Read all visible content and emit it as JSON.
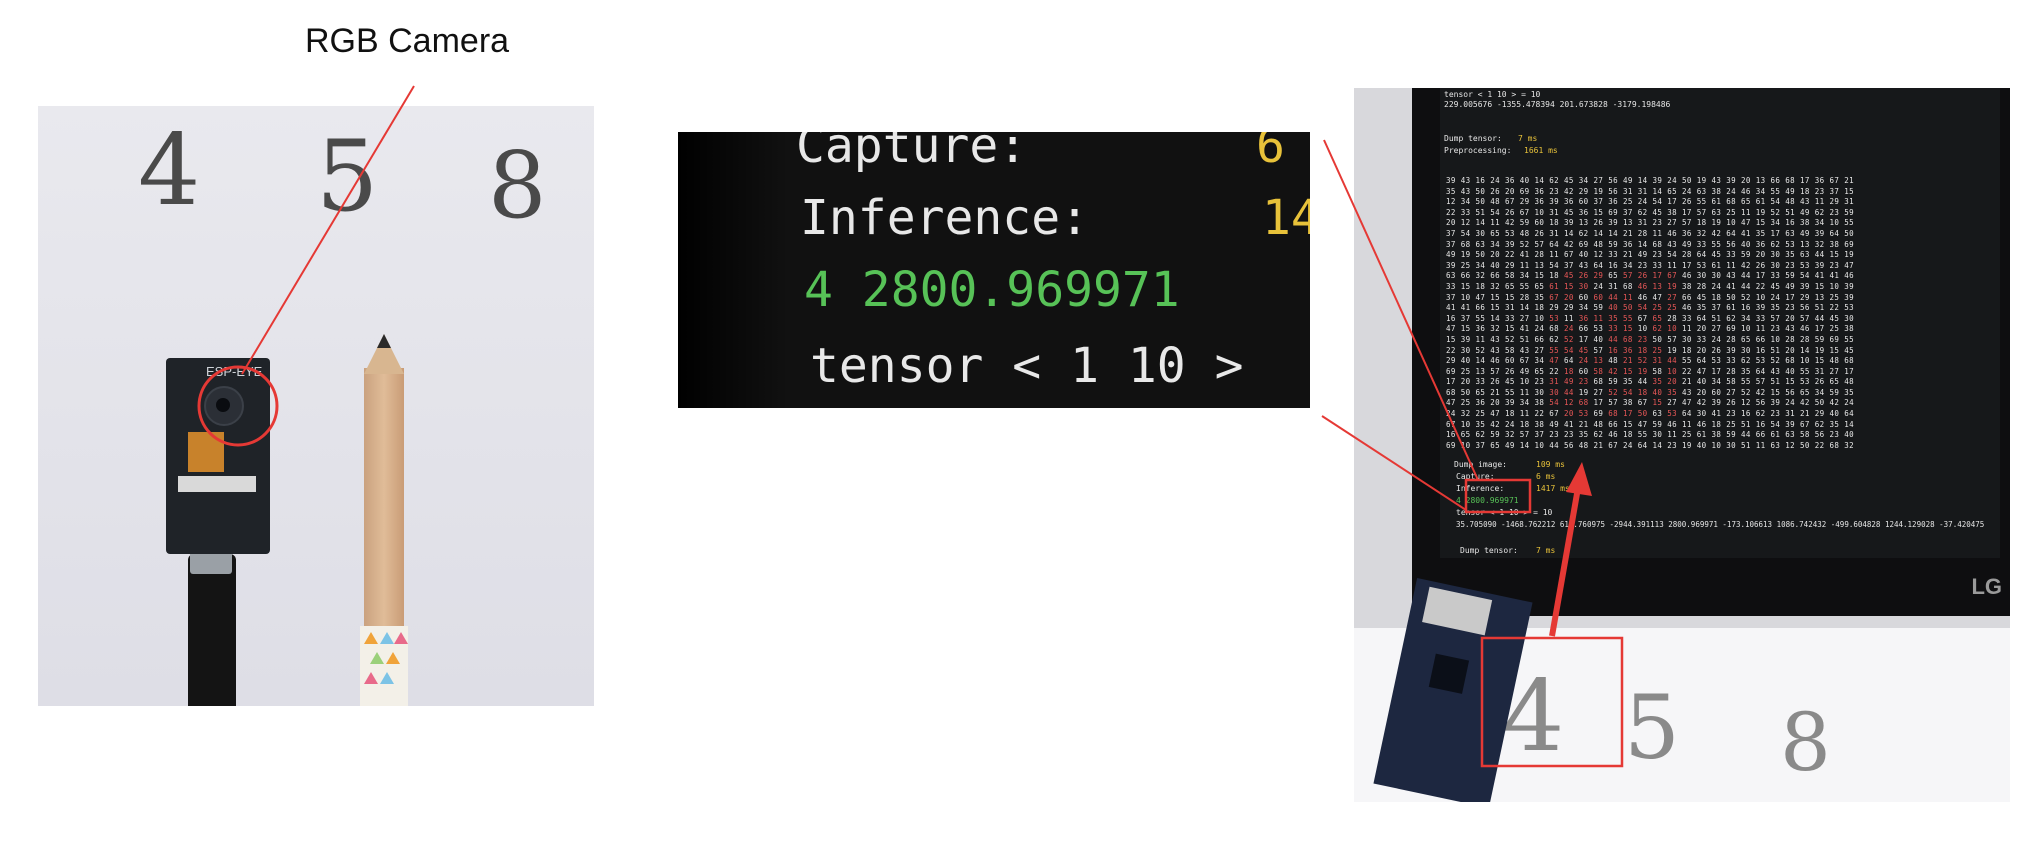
{
  "title": "RGB Camera",
  "left_photo": {
    "digits": [
      "4",
      "5",
      "8"
    ],
    "board_silkscreen": "ESP-EYE"
  },
  "inset": {
    "lines": [
      {
        "text": "Capture:",
        "color": "#e8e8e8"
      },
      {
        "text": "Inference:",
        "color": "#e8e8e8"
      },
      {
        "text": "4 2800.969971",
        "color": "#57c257"
      },
      {
        "text": "tensor < 1 10 >",
        "color": "#e8e8e8"
      }
    ],
    "side_values": [
      "6",
      "14"
    ]
  },
  "screen": {
    "top_lines": [
      "tensor < 1 10 > = 10",
      "229.005676 -1355.478394 201.673828 -3179.198486"
    ],
    "dump_tensor": "Dump tensor:",
    "dump_tensor_value": "7 ms",
    "preprocessing": "Preprocessing:",
    "preprocessing_value": "1661 ms",
    "dump_image": "Dump image:",
    "dump_image_value": "109 ms",
    "capture": "Capture:",
    "capture_value": "6 ms",
    "inference": "Inference:",
    "inference_value": "1417 ms",
    "result": "4 2800.969971",
    "tensor_line": "tensor < 1 10 > = 10",
    "values_line": "35.705090 -1468.762212 611.760975 -2944.391113 2800.969971 -173.106613 1086.742432 -499.604828 1244.129028 -37.420475",
    "dump_tensor2": "Dump tensor:",
    "dump_tensor2_value": "7 ms",
    "brand": "LG"
  },
  "right_photo": {
    "digits": [
      "4",
      "5",
      "8"
    ]
  },
  "colors": {
    "annotation": "#e53935",
    "terminal_green": "#57c257",
    "terminal_yellow": "#e8c23a"
  }
}
